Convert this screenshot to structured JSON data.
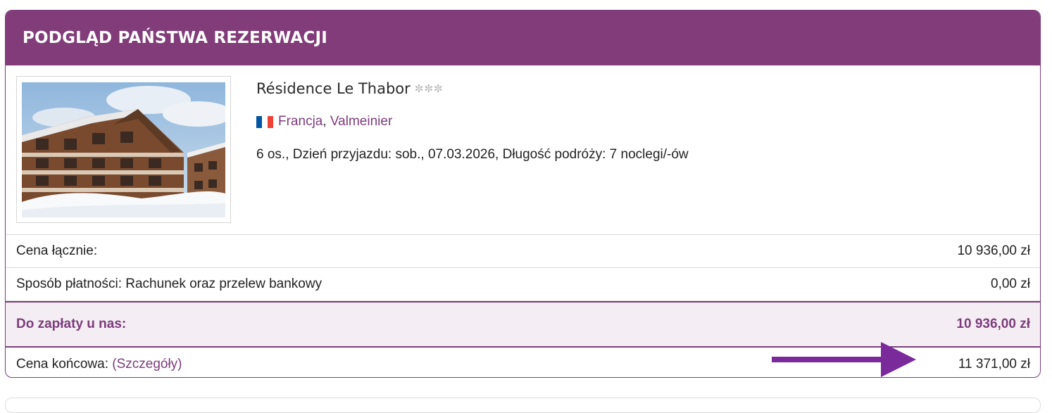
{
  "header": {
    "title": "PODGLĄD PAŃSTWA REZERWACJI"
  },
  "hotel": {
    "name": "Résidence Le Thabor",
    "stars": 3,
    "country": "Francja",
    "separator": ",",
    "town": "Valmeinier",
    "details": "6 os., Dzień przyjazdu: sob., 07.03.2026, Długość podróży: 7 noclegi/-ów",
    "flag_colors": [
      "#0055a4",
      "#ffffff",
      "#ef4135"
    ]
  },
  "pricing": {
    "total_label": "Cena łącznie:",
    "total_value": "10 936,00 zł",
    "payment_label": "Sposób płatności: Rachunek oraz przelew bankowy",
    "payment_value": "0,00 zł",
    "due_label": "Do zapłaty u nas:",
    "due_value": "10 936,00 zł",
    "final_label": "Cena końcowa:",
    "final_link": "(Szczegóły)",
    "final_value": "11 371,00 zł"
  },
  "colors": {
    "accent": "#813c79",
    "arrow": "#7a2a9a"
  },
  "icons": {
    "star": "snowflake-star-icon",
    "flag": "france-flag-icon",
    "arrow": "arrow-right-icon"
  }
}
